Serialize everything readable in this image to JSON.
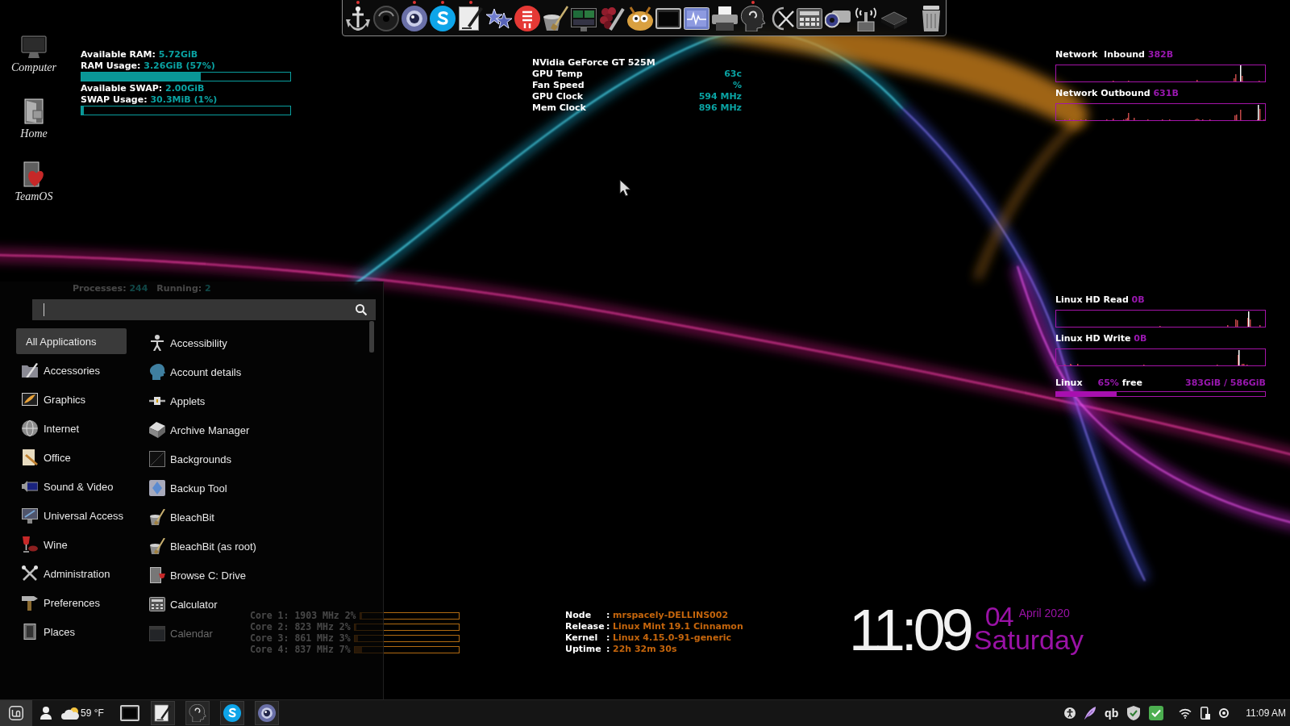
{
  "desktop_icons": [
    {
      "label": "Computer"
    },
    {
      "label": "Home"
    },
    {
      "label": "TeamOS"
    }
  ],
  "dock": {
    "items": [
      {
        "running": true
      },
      {
        "running": false
      },
      {
        "running": true
      },
      {
        "running": true
      },
      {
        "running": true
      },
      {
        "running": false
      },
      {
        "running": false
      },
      {
        "running": false
      },
      {
        "running": false
      },
      {
        "running": false
      },
      {
        "running": false
      },
      {
        "running": false
      },
      {
        "running": false
      },
      {
        "running": false
      },
      {
        "running": true
      },
      {
        "running": false
      },
      {
        "running": false
      },
      {
        "running": false
      },
      {
        "running": false
      },
      {
        "running": false
      },
      {
        "running": false
      }
    ]
  },
  "memory": [
    {
      "available_label": "Available RAM:",
      "available": "5.72GiB",
      "usage_label": "RAM Usage:",
      "usage": "3.26GiB (57%)",
      "level": 0.57
    },
    {
      "available_label": "Available SWAP:",
      "available": "2.00GiB",
      "usage_label": "SWAP Usage:",
      "usage": "30.3MiB (1%)",
      "level": 0.01
    }
  ],
  "gpu": {
    "title": "NVidia GeForce GT 525M",
    "rows": [
      {
        "label": "GPU Temp",
        "value": "63c"
      },
      {
        "label": "Fan Speed",
        "value": "%"
      },
      {
        "label": "GPU Clock",
        "value": "594 MHz"
      },
      {
        "label": "Mem Clock",
        "value": "896 MHz"
      }
    ]
  },
  "network": [
    {
      "label": "Network  Inbound",
      "value": "382B"
    },
    {
      "label": "Network Outbound",
      "value": "631B"
    }
  ],
  "disk_io": [
    {
      "label": "Linux HD Read",
      "value": "0B"
    },
    {
      "label": "Linux HD Write",
      "value": "0B"
    }
  ],
  "disk_usage": {
    "label": "Linux",
    "percent": "65%",
    "free_label": "free",
    "size": "383GiB / 586GiB",
    "level": 0.29
  },
  "processes": {
    "label": "Processes:",
    "count": "244",
    "running_label": "Running:",
    "running": "2"
  },
  "menu": {
    "categories": [
      {
        "label": "All Applications",
        "selected": true
      },
      {
        "label": "Accessories",
        "selected": false
      },
      {
        "label": "Graphics",
        "selected": false
      },
      {
        "label": "Internet",
        "selected": false
      },
      {
        "label": "Office",
        "selected": false
      },
      {
        "label": "Sound & Video",
        "selected": false
      },
      {
        "label": "Universal Access",
        "selected": false
      },
      {
        "label": "Wine",
        "selected": false
      },
      {
        "label": "Administration",
        "selected": false
      },
      {
        "label": "Preferences",
        "selected": false
      },
      {
        "label": "Places",
        "selected": false
      }
    ],
    "apps": [
      {
        "label": "Accessibility",
        "faded": false
      },
      {
        "label": "Account details",
        "faded": false
      },
      {
        "label": "Applets",
        "faded": false
      },
      {
        "label": "Archive Manager",
        "faded": false
      },
      {
        "label": "Backgrounds",
        "faded": false
      },
      {
        "label": "Backup Tool",
        "faded": false
      },
      {
        "label": "BleachBit",
        "faded": false
      },
      {
        "label": "BleachBit (as root)",
        "faded": false
      },
      {
        "label": "Browse C: Drive",
        "faded": false
      },
      {
        "label": "Calculator",
        "faded": false
      },
      {
        "label": "Calendar",
        "faded": true
      }
    ]
  },
  "cpu_cores": [
    {
      "label": "Core 1: 1903 MHz 2%",
      "level": 0.02
    },
    {
      "label": "Core 2: 823 MHz 2%",
      "level": 0.02
    },
    {
      "label": "Core 3: 861 MHz 3%",
      "level": 0.03
    },
    {
      "label": "Core 4: 837 MHz 7%",
      "level": 0.07
    }
  ],
  "system_info": [
    {
      "label": "Node",
      "separator": ":",
      "value": "mrspacely-DELLINS002"
    },
    {
      "label": "Release",
      "separator": ":",
      "value": "Linux Mint 19.1 Cinnamon"
    },
    {
      "label": "Kernel",
      "separator": ":",
      "value": "Linux 4.15.0-91-generic"
    },
    {
      "label": "Uptime",
      "separator": ":",
      "value": "22h 32m 30s"
    }
  ],
  "clock": {
    "time": "11:09",
    "day": "04",
    "month_year": "April 2020",
    "weekday": "Saturday"
  },
  "taskbar": {
    "weather": "59 °F",
    "tray_text": "qb",
    "clock": "11:09 AM"
  }
}
